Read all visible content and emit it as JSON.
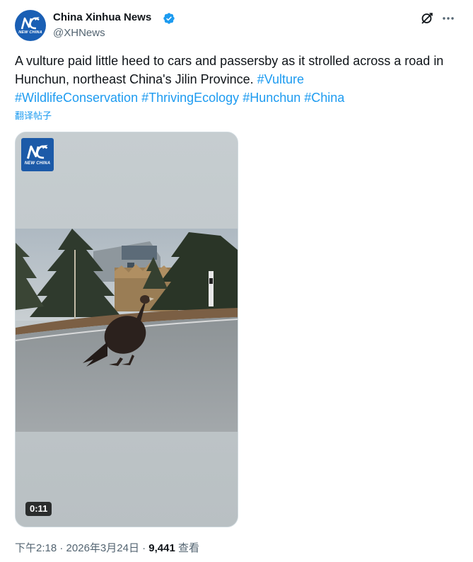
{
  "author": {
    "name": "China Xinhua News",
    "handle": "@XHNews",
    "verified": true,
    "avatar_logo_text": "NEW CHINA"
  },
  "header_icons": [
    "grok-icon",
    "more-icon"
  ],
  "tweet": {
    "text": "A vulture paid little heed to cars and passersby as it strolled across a road in Hunchun, northeast China's Jilin Province.",
    "hashtags": [
      "#Vulture",
      "#WildlifeConservation",
      "#ThrivingEcology",
      "#Hunchun",
      "#China"
    ],
    "translate_label": "翻译帖子"
  },
  "media": {
    "type": "video",
    "watermark_text": "NEW CHINA",
    "duration": "0:11"
  },
  "meta": {
    "time": "下午2:18",
    "separator": "·",
    "date": "2026年3月24日",
    "views_count": "9,441",
    "views_label": "查看"
  },
  "colors": {
    "accent": "#1d9bf0",
    "text": "#0f1419",
    "secondary_text": "#536471",
    "brand_blue": "#1a5fb4"
  }
}
